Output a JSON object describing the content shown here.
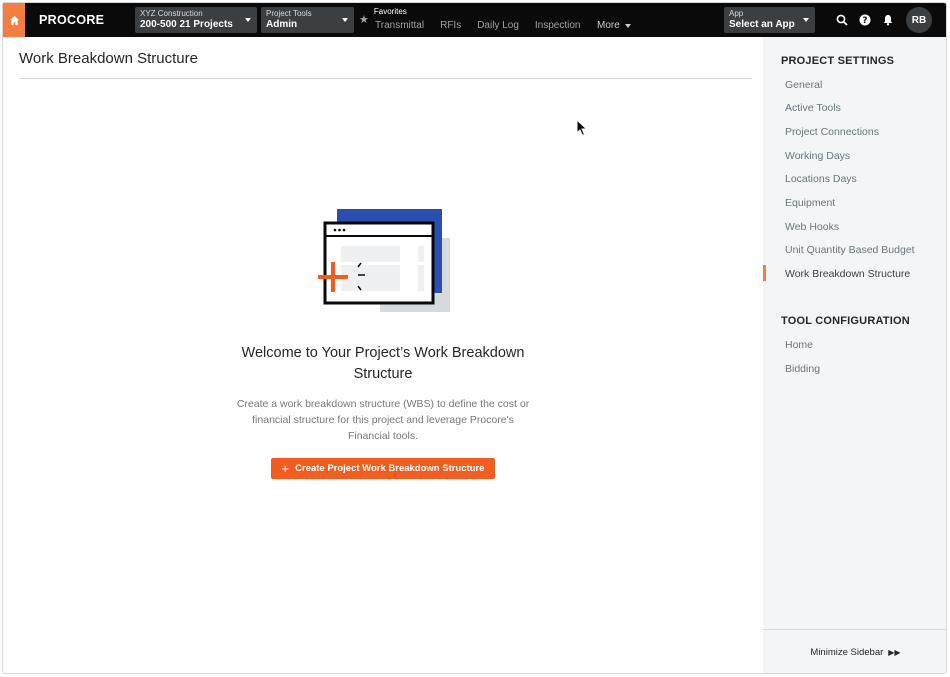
{
  "topbar": {
    "logo": "PROCORE",
    "company": {
      "label": "XYZ Construction",
      "value": "200-500 21 Projects"
    },
    "tools": {
      "label": "Project Tools",
      "value": "Admin"
    },
    "favorites": {
      "label": "Favorites",
      "links": [
        "Transmittal",
        "RFIs",
        "Daily Log",
        "Inspection"
      ]
    },
    "more_label": "More",
    "app": {
      "label": "App",
      "value": "Select an App"
    },
    "avatar_initials": "RB",
    "icons": [
      "home-icon",
      "star-icon",
      "search-icon",
      "help-icon",
      "bell-icon"
    ]
  },
  "main": {
    "page_title": "Work Breakdown Structure",
    "welcome_title": "Welcome to Your Project’s Work Breakdown Structure",
    "description": "Create a work breakdown structure (WBS) to define the cost or financial structure for this project and leverage Procore's Financial tools.",
    "create_button": "Create Project Work Breakdown Structure"
  },
  "sidebar": {
    "project_settings_heading": "PROJECT SETTINGS",
    "project_settings_items": [
      "General",
      "Active Tools",
      "Project Connections",
      "Working Days",
      "Locations Days",
      "Equipment",
      "Web Hooks",
      "Unit Quantity Based Budget",
      "Work Breakdown Structure"
    ],
    "active_item": "Work Breakdown Structure",
    "tool_config_heading": "TOOL CONFIGURATION",
    "tool_config_items": [
      "Home",
      "Bidding"
    ],
    "minimize_label": "Minimize Sidebar"
  },
  "colors": {
    "brand_orange": "#f47e42",
    "button_orange": "#f25d1f",
    "illustration_blue": "#2b4fb0",
    "topbar_bg": "#0a0a0a"
  }
}
